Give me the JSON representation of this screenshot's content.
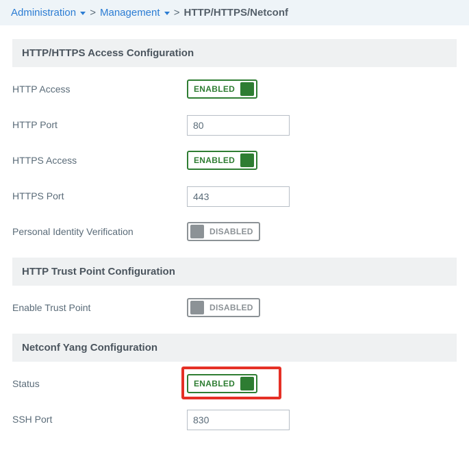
{
  "breadcrumb": {
    "item1": "Administration",
    "item2": "Management",
    "current": "HTTP/HTTPS/Netconf"
  },
  "sections": {
    "http_https": {
      "title": "HTTP/HTTPS Access Configuration",
      "http_access_label": "HTTP Access",
      "http_port_label": "HTTP Port",
      "http_port_value": "80",
      "https_access_label": "HTTPS Access",
      "https_port_label": "HTTPS Port",
      "https_port_value": "443",
      "piv_label": "Personal Identity Verification"
    },
    "trustpoint": {
      "title": "HTTP Trust Point Configuration",
      "enable_label": "Enable Trust Point"
    },
    "netconf": {
      "title": "Netconf Yang Configuration",
      "status_label": "Status",
      "ssh_port_label": "SSH Port",
      "ssh_port_value": "830"
    }
  },
  "toggle": {
    "enabled_text": "ENABLED",
    "disabled_text": "DISABLED"
  }
}
